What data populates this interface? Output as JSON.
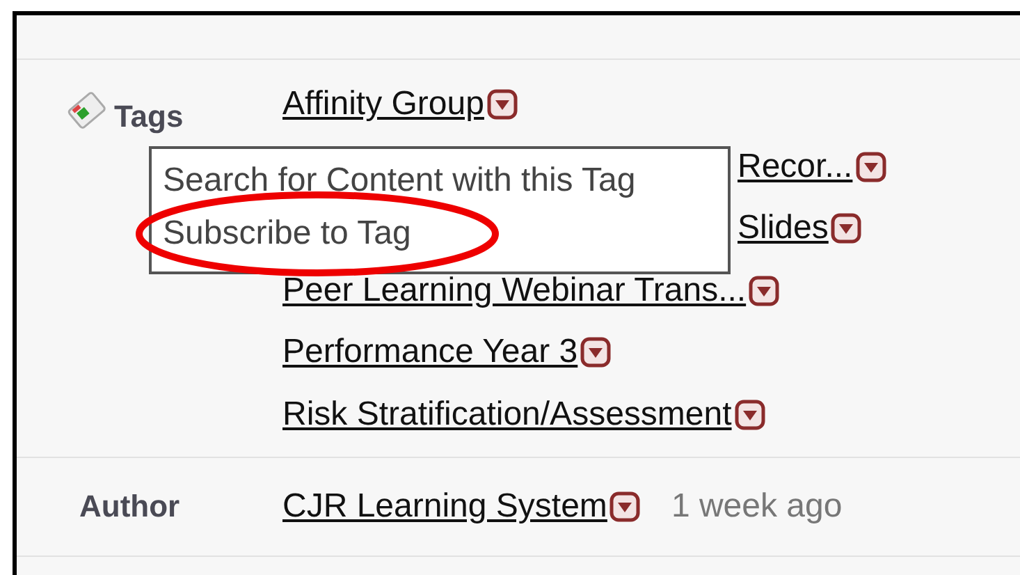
{
  "tags": {
    "label": "Tags",
    "items": [
      {
        "text": "Affinity Group",
        "partial": false
      },
      {
        "text": "Recor...",
        "partial": true
      },
      {
        "text": "Slides",
        "partial": true
      },
      {
        "text": "Peer Learning Webinar Trans...",
        "partial": false
      },
      {
        "text": "Performance Year 3",
        "partial": false
      },
      {
        "text": "Risk Stratification/Assessment",
        "partial": false
      }
    ]
  },
  "menu": {
    "items": [
      {
        "text": "Search for Content with this Tag",
        "highlighted": false
      },
      {
        "text": "Subscribe to Tag",
        "highlighted": true
      }
    ]
  },
  "author": {
    "label": "Author",
    "name": "CJR Learning System",
    "time": "1 week ago"
  }
}
